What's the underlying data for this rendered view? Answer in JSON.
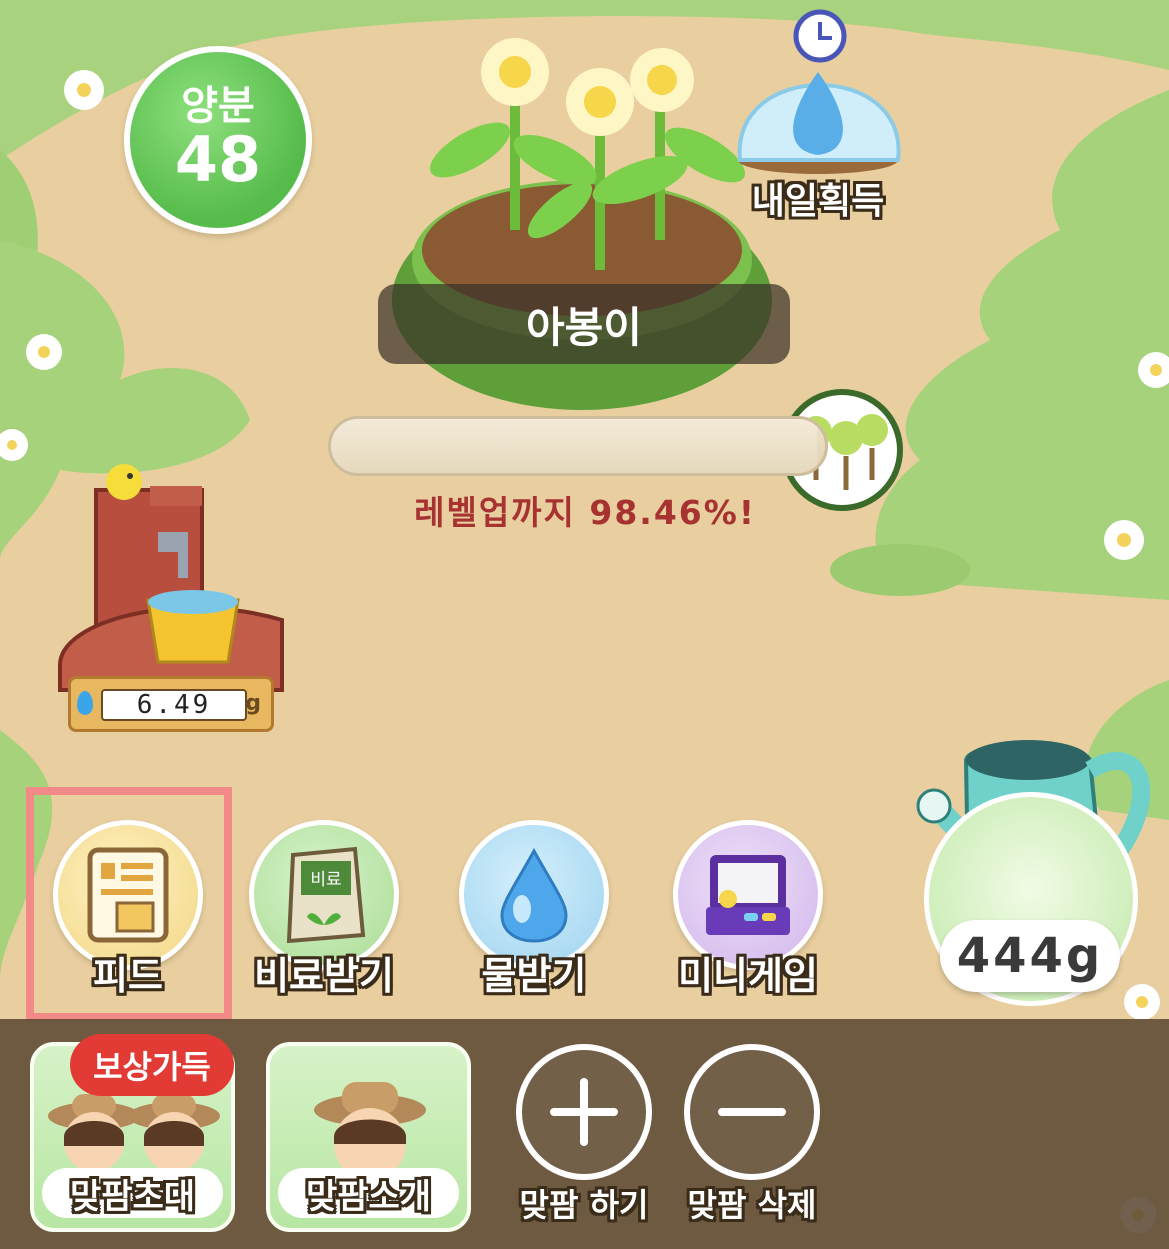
{
  "status": {
    "nutrient_label": "양분",
    "nutrient_value": "48",
    "tomorrow_label": "내일획득"
  },
  "plant": {
    "name": "아봉이",
    "progress_percent": 98.46,
    "levelup_text": "레벨업까지 98.46%!"
  },
  "water_tank": {
    "value": "6.49",
    "unit": "g"
  },
  "actions": [
    {
      "label": "피드",
      "icon": "feed-icon"
    },
    {
      "label": "비료받기",
      "icon": "fertilizer-bag-icon",
      "bag_text": "비료"
    },
    {
      "label": "물받기",
      "icon": "water-drop-icon"
    },
    {
      "label": "미니게임",
      "icon": "arcade-icon"
    }
  ],
  "watering_can": {
    "amount": "444g",
    "icon": "watering-can-icon"
  },
  "bottom": {
    "invite_label": "맞팜초대",
    "reward_badge": "보상가득",
    "intro_label": "맞팜소개",
    "add_label": "맞팜 하기",
    "delete_label": "맞팜 삭제"
  },
  "colors": {
    "highlight": "#f28b87",
    "progress_text": "#a63232",
    "nutrient_green": "#55bb4a",
    "badge_red": "#e23b35"
  }
}
